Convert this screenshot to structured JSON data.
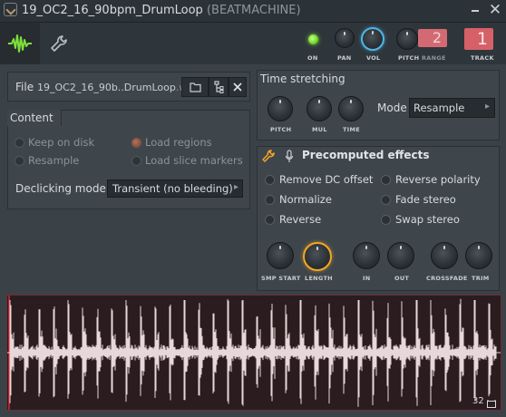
{
  "window": {
    "title_main": "19_OC2_16_90bpm_DrumLoop",
    "title_plugin": "(BEATMACHINE)",
    "close_glyph": "✕"
  },
  "toolbar": {
    "on_label": "ON",
    "pan_label": "PAN",
    "vol_label": "VOL",
    "pitch_label": "PITCH",
    "range_label": "RANGE",
    "range_value": "2",
    "track_label": "TRACK",
    "track_value": "1"
  },
  "file": {
    "label": "File",
    "name": "19_OC2_16_90b..DrumLoop",
    "ext": ".wav"
  },
  "content": {
    "title": "Content",
    "options": [
      "Keep on disk",
      "Load regions",
      "Resample",
      "Load slice markers"
    ],
    "declicking_label": "Declicking mode",
    "declicking_value": "Transient (no bleeding)"
  },
  "time_stretching": {
    "title": "Time stretching",
    "knobs": [
      "PITCH",
      "MUL",
      "TIME"
    ],
    "mode_label": "Mode",
    "mode_value": "Resample"
  },
  "precomputed": {
    "title": "Precomputed effects",
    "options": [
      "Remove DC offset",
      "Reverse polarity",
      "Normalize",
      "Fade stereo",
      "Reverse",
      "Swap stereo"
    ],
    "knobs": [
      "SMP START",
      "LENGTH",
      "IN",
      "OUT",
      "CROSSFADE",
      "TRIM"
    ]
  },
  "waveform": {
    "zoom_value": "32"
  },
  "colors": {
    "accent_orange": "#f5a623",
    "accent_blue": "#4fb6e8",
    "led_green": "#6fd62a",
    "track_red": "#d66068",
    "wave_fill": "#e8d7da",
    "wave_bg": "#2b1c1f"
  }
}
